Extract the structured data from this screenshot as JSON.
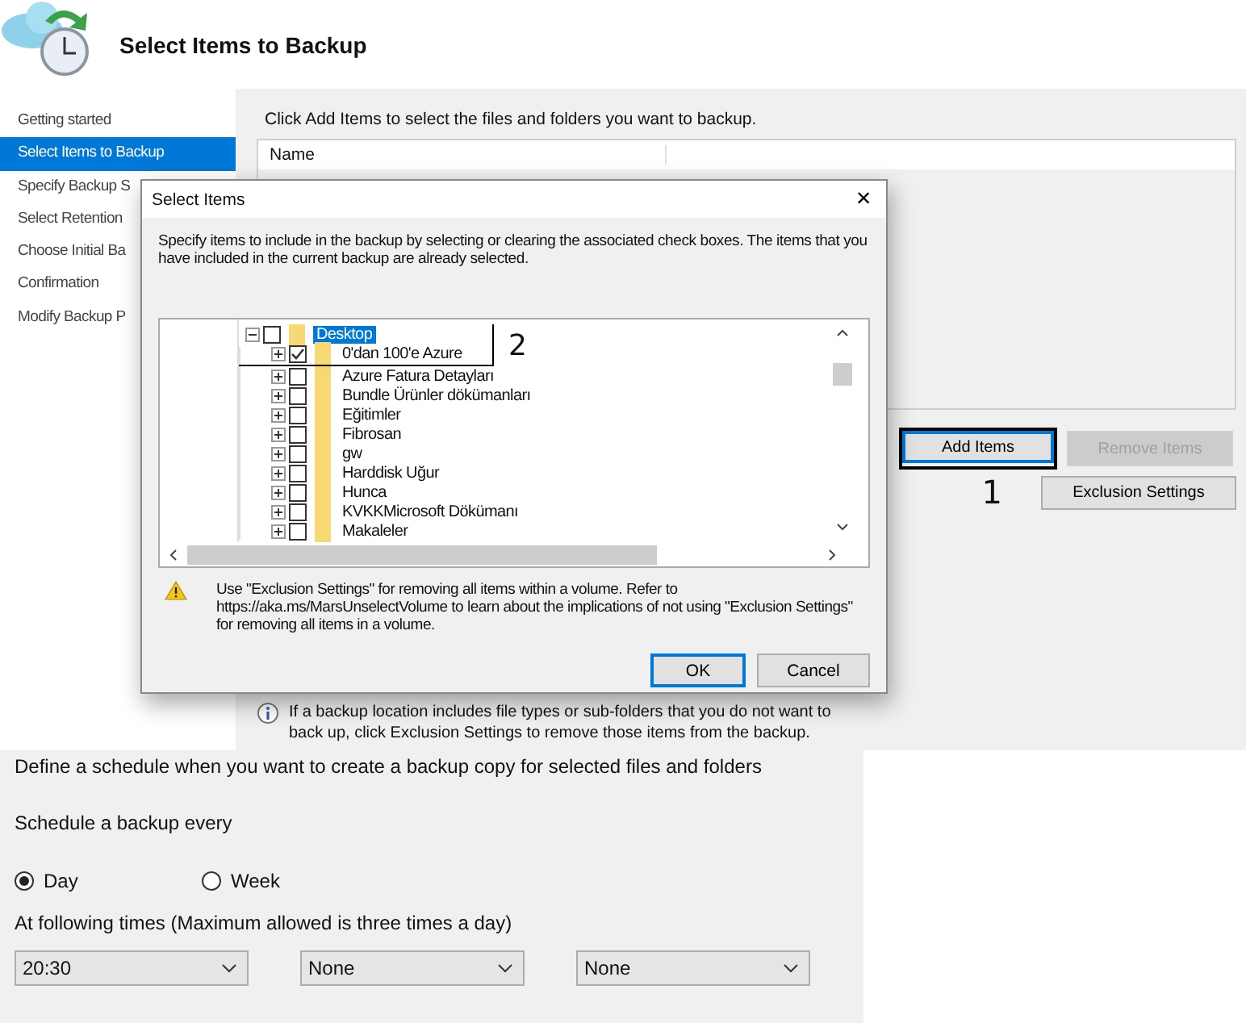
{
  "header": {
    "title": "Select Items to Backup"
  },
  "sidebar": {
    "items": [
      {
        "label": "Getting started",
        "selected": false
      },
      {
        "label": "Select Items to Backup",
        "selected": true
      },
      {
        "label": "Specify Backup S",
        "selected": false
      },
      {
        "label": "Select Retention",
        "selected": false
      },
      {
        "label": "Choose Initial Ba",
        "selected": false
      },
      {
        "label": "Confirmation",
        "selected": false
      },
      {
        "label": "Modify Backup P",
        "selected": false
      }
    ]
  },
  "items_panel": {
    "instruction": "Click Add Items to select the files and folders you want to backup.",
    "columns": [
      "Name"
    ],
    "buttons": [
      {
        "label": "Add Items",
        "disabled": false,
        "annotated": true
      },
      {
        "label": "Remove Items",
        "disabled": true,
        "annotated": false
      }
    ],
    "exclusion_button": "Exclusion Settings",
    "annotation_number": "1",
    "info_note": "If a backup location includes file types or sub-folders that you do not want to back up, click Exclusion Settings to remove those items from the backup."
  },
  "dialog": {
    "title": "Select Items",
    "close": "×",
    "description": "Specify items to include in the backup by selecting or clearing the associated check boxes. The items that you have included in the current backup are already selected.",
    "tree": [
      {
        "label": "Desktop",
        "checked": false,
        "expanded": true,
        "selected": true,
        "children": [
          {
            "label": "0'dan 100'e Azure",
            "checked": true,
            "expanded": false,
            "selected": false
          },
          {
            "label": "Azure Fatura Detayları",
            "checked": false,
            "expanded": false,
            "selected": false
          },
          {
            "label": "Bundle Ürünler dökümanları",
            "checked": false,
            "expanded": false,
            "selected": false
          },
          {
            "label": "Eğitimler",
            "checked": false,
            "expanded": false,
            "selected": false
          },
          {
            "label": "Fibrosan",
            "checked": false,
            "expanded": false,
            "selected": false
          },
          {
            "label": "gw",
            "checked": false,
            "expanded": false,
            "selected": false
          },
          {
            "label": "Harddisk Uğur",
            "checked": false,
            "expanded": false,
            "selected": false
          },
          {
            "label": "Hunca",
            "checked": false,
            "expanded": false,
            "selected": false
          },
          {
            "label": "KVKKMicrosoft Dökümanı",
            "checked": false,
            "expanded": false,
            "selected": false
          },
          {
            "label": "Makaleler",
            "checked": false,
            "expanded": false,
            "selected": false
          }
        ]
      }
    ],
    "annotation_number": "2",
    "warning": "Use \"Exclusion Settings\" for removing all items within a volume. Refer to https://aka.ms/MarsUnselectVolume to learn about the implications of not using \"Exclusion Settings\" for removing all items in a volume.",
    "buttons": [
      {
        "label": "OK",
        "default": true
      },
      {
        "label": "Cancel",
        "default": false
      }
    ]
  },
  "schedule": {
    "heading": "Define a schedule when you want to create a backup copy for selected files and folders",
    "frequency_label": "Schedule a backup every",
    "options": [
      {
        "label": "Day",
        "selected": true
      },
      {
        "label": "Week",
        "selected": false
      }
    ],
    "times_label": "At following times (Maximum allowed is three times a day)",
    "times": [
      "20:30",
      "None",
      "None"
    ]
  }
}
